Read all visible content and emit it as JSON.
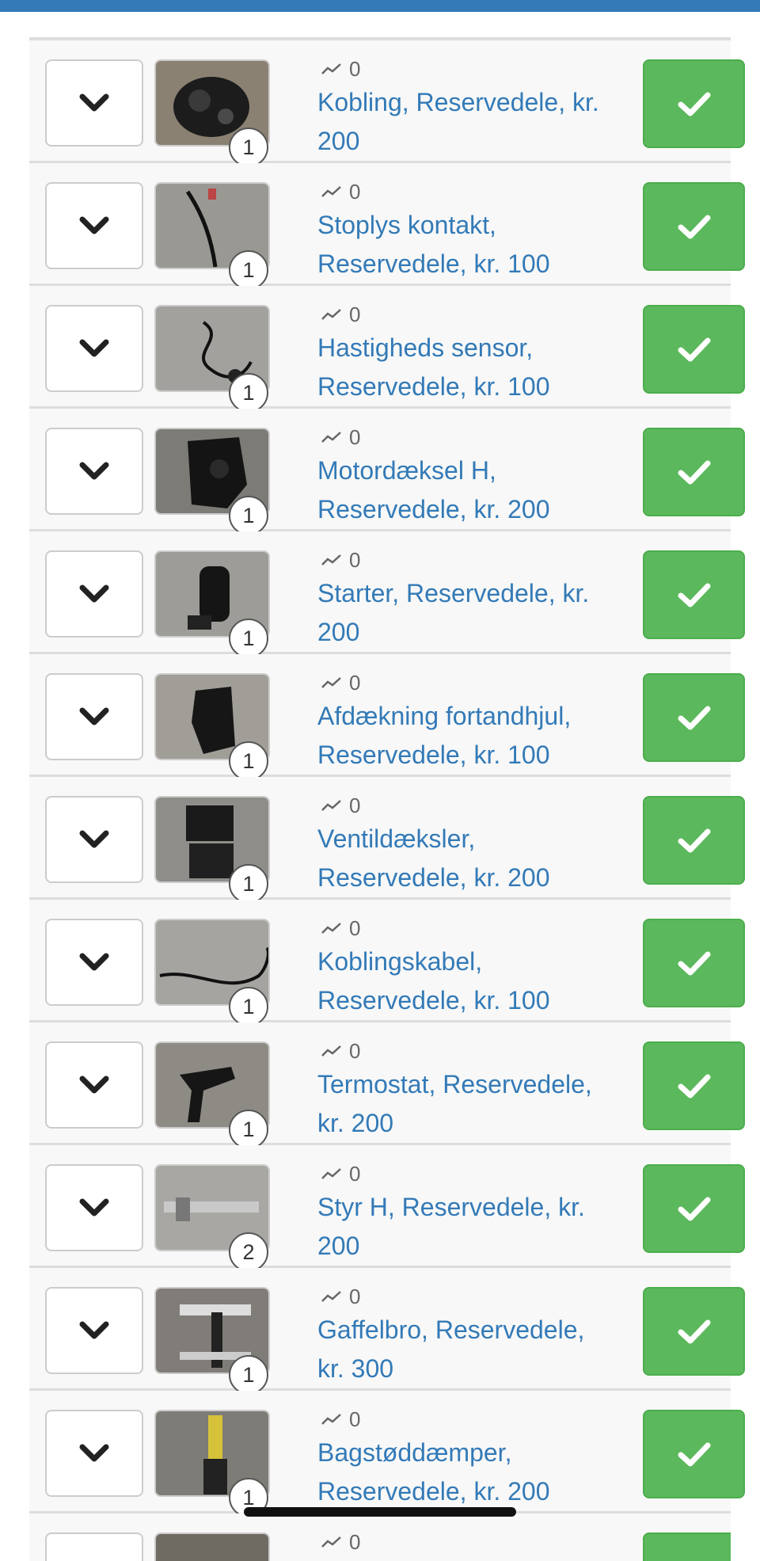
{
  "colors": {
    "header": "#337ab7",
    "link": "#337ab7",
    "success": "#5cb85c"
  },
  "icons": {
    "expand": "chevron-down-icon",
    "confirm": "checkmark-icon",
    "stats": "trend-line-icon"
  },
  "listings": [
    {
      "title": "Kobling, Reservedele, kr. 200",
      "stat": "0",
      "photo_count": "1"
    },
    {
      "title": "Stoplys kontakt, Reservedele, kr. 100",
      "stat": "0",
      "photo_count": "1"
    },
    {
      "title": "Hastigheds sensor, Reservedele, kr. 100",
      "stat": "0",
      "photo_count": "1"
    },
    {
      "title": "Motordæksel H, Reservedele, kr. 200",
      "stat": "0",
      "photo_count": "1"
    },
    {
      "title": "Starter, Reservedele, kr. 200",
      "stat": "0",
      "photo_count": "1"
    },
    {
      "title": "Afdækning fortandhjul, Reservedele, kr. 100",
      "stat": "0",
      "photo_count": "1"
    },
    {
      "title": "Ventildæksler, Reservedele, kr. 200",
      "stat": "0",
      "photo_count": "1"
    },
    {
      "title": "Koblingskabel, Reservedele, kr. 100",
      "stat": "0",
      "photo_count": "1"
    },
    {
      "title": "Termostat, Reservedele, kr. 200",
      "stat": "0",
      "photo_count": "1"
    },
    {
      "title": "Styr H, Reservedele, kr. 200",
      "stat": "0",
      "photo_count": "2"
    },
    {
      "title": "Gaffelbro, Reservedele, kr. 300",
      "stat": "0",
      "photo_count": "1"
    },
    {
      "title": "Bagstøddæmper, Reservedele, kr. 200",
      "stat": "0",
      "photo_count": "1"
    }
  ],
  "partial_row": {
    "stat": "0"
  }
}
